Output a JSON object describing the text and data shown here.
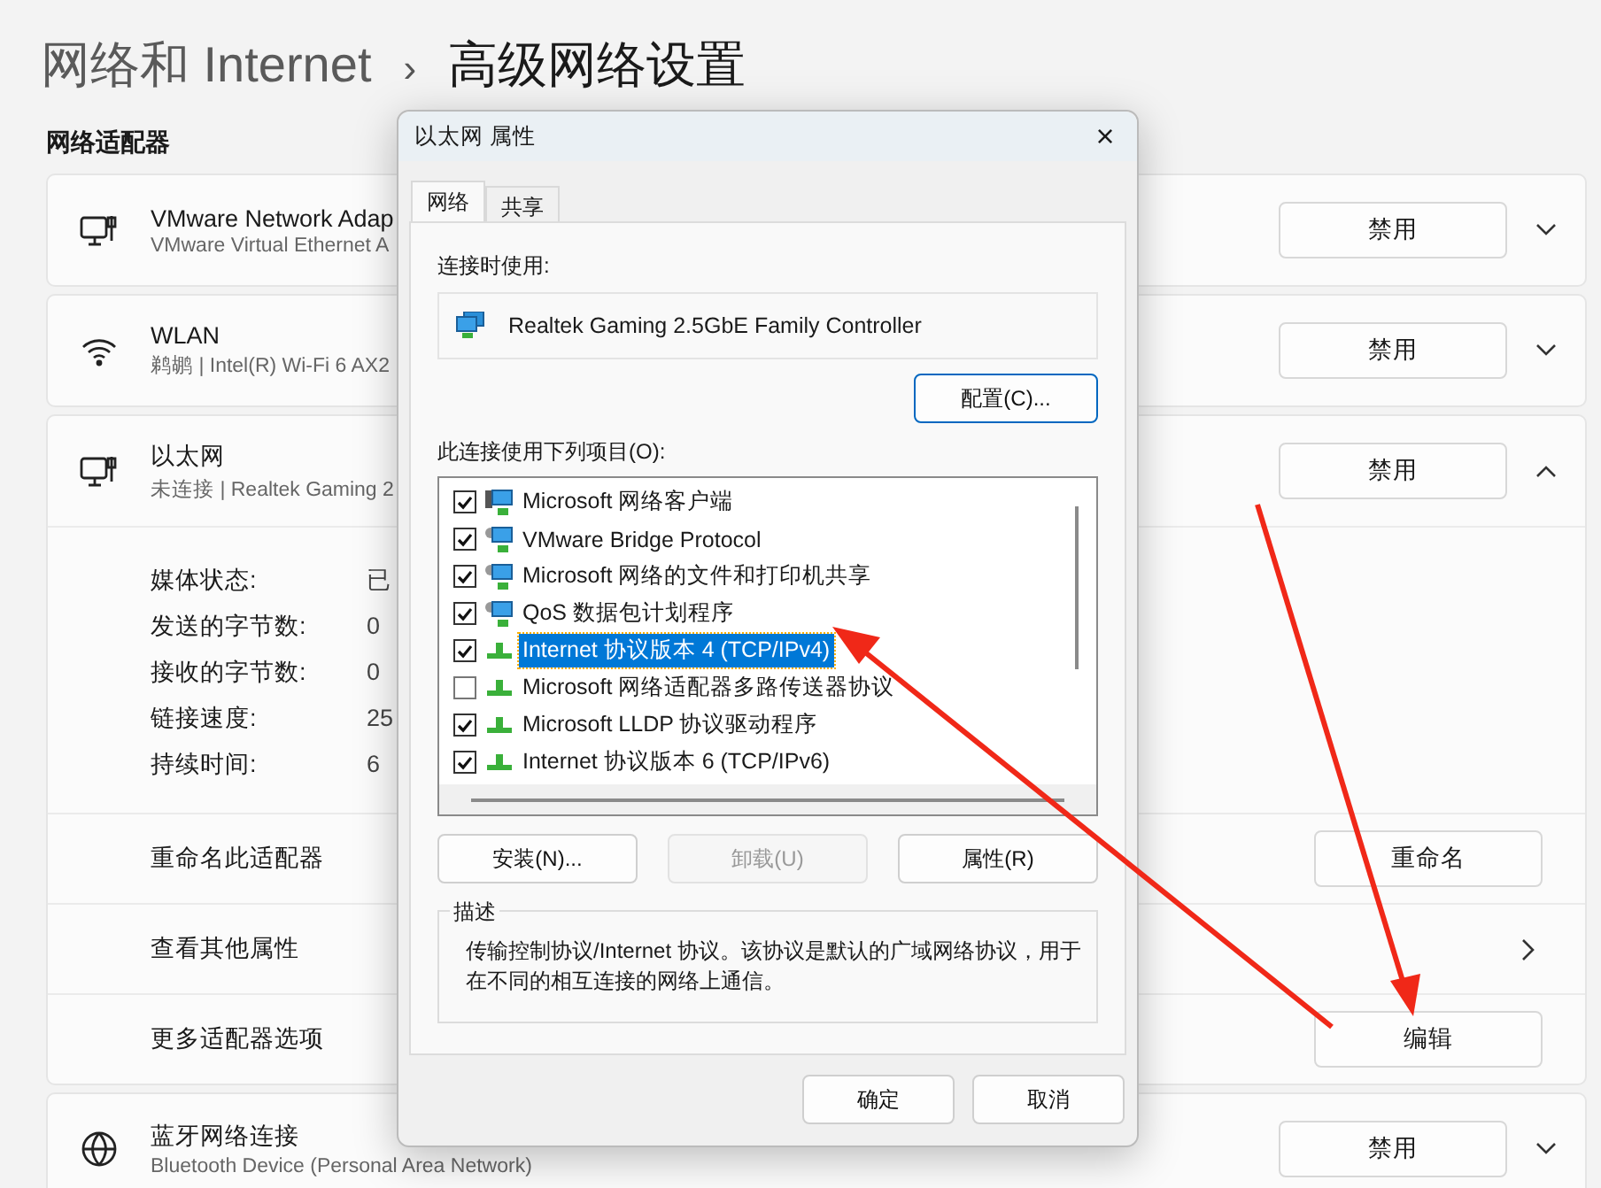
{
  "breadcrumb": {
    "parent": "网络和 Internet",
    "separator": "›",
    "current": "高级网络设置"
  },
  "section_title": "网络适配器",
  "adapters": [
    {
      "kind": "ethernet",
      "name": "VMware Network Adap",
      "description": "VMware Virtual Ethernet A",
      "button": "禁用",
      "expanded": false
    },
    {
      "kind": "wifi",
      "name": "WLAN",
      "description": "鹈鹕 | Intel(R) Wi-Fi 6 AX2",
      "button": "禁用",
      "expanded": false
    },
    {
      "kind": "ethernet",
      "name": "以太网",
      "description": "未连接 | Realtek Gaming 2",
      "button": "禁用",
      "expanded": true,
      "details": [
        {
          "label": "媒体状态:",
          "value": "已"
        },
        {
          "label": "发送的字节数:",
          "value": "0"
        },
        {
          "label": "接收的字节数:",
          "value": "0"
        },
        {
          "label": "链接速度:",
          "value": "25"
        },
        {
          "label": "持续时间:",
          "value": "6"
        }
      ],
      "actions": [
        {
          "kind": "button",
          "label": "重命名此适配器",
          "button": "重命名"
        },
        {
          "kind": "link",
          "label": "查看其他属性"
        },
        {
          "kind": "button",
          "label": "更多适配器选项",
          "button": "编辑"
        }
      ]
    },
    {
      "kind": "globe",
      "name": "蓝牙网络连接",
      "description": "Bluetooth Device (Personal Area Network)",
      "button": "禁用",
      "expanded": false
    }
  ],
  "dialog": {
    "title": "以太网 属性",
    "close": "×",
    "tabs": [
      {
        "label": "网络",
        "selected": true
      },
      {
        "label": "共享",
        "selected": false
      }
    ],
    "connect_using_label": "连接时使用:",
    "adapter": "Realtek Gaming 2.5GbE Family Controller",
    "configure_button": "配置(C)...",
    "items_label": "此连接使用下列项目(O):",
    "items": [
      {
        "kind": "client",
        "label": "Microsoft 网络客户端",
        "checked": true,
        "selected": false
      },
      {
        "kind": "service",
        "label": "VMware Bridge Protocol",
        "checked": true,
        "selected": false
      },
      {
        "kind": "service",
        "label": "Microsoft 网络的文件和打印机共享",
        "checked": true,
        "selected": false
      },
      {
        "kind": "service",
        "label": "QoS 数据包计划程序",
        "checked": true,
        "selected": false
      },
      {
        "kind": "protocol",
        "label": "Internet 协议版本 4 (TCP/IPv4)",
        "checked": true,
        "selected": true
      },
      {
        "kind": "protocol",
        "label": "Microsoft 网络适配器多路传送器协议",
        "checked": false,
        "selected": false
      },
      {
        "kind": "protocol",
        "label": "Microsoft LLDP 协议驱动程序",
        "checked": true,
        "selected": false
      },
      {
        "kind": "protocol",
        "label": "Internet 协议版本 6 (TCP/IPv6)",
        "checked": true,
        "selected": false
      }
    ],
    "buttons": [
      {
        "label": "安装(N)...",
        "disabled": false
      },
      {
        "label": "卸载(U)",
        "disabled": true
      },
      {
        "label": "属性(R)",
        "disabled": false
      }
    ],
    "description_title": "描述",
    "description": "传输控制协议/Internet 协议。该协议是默认的广域网络协议，用于在不同的相互连接的网络上通信。",
    "ok": "确定",
    "cancel": "取消"
  }
}
